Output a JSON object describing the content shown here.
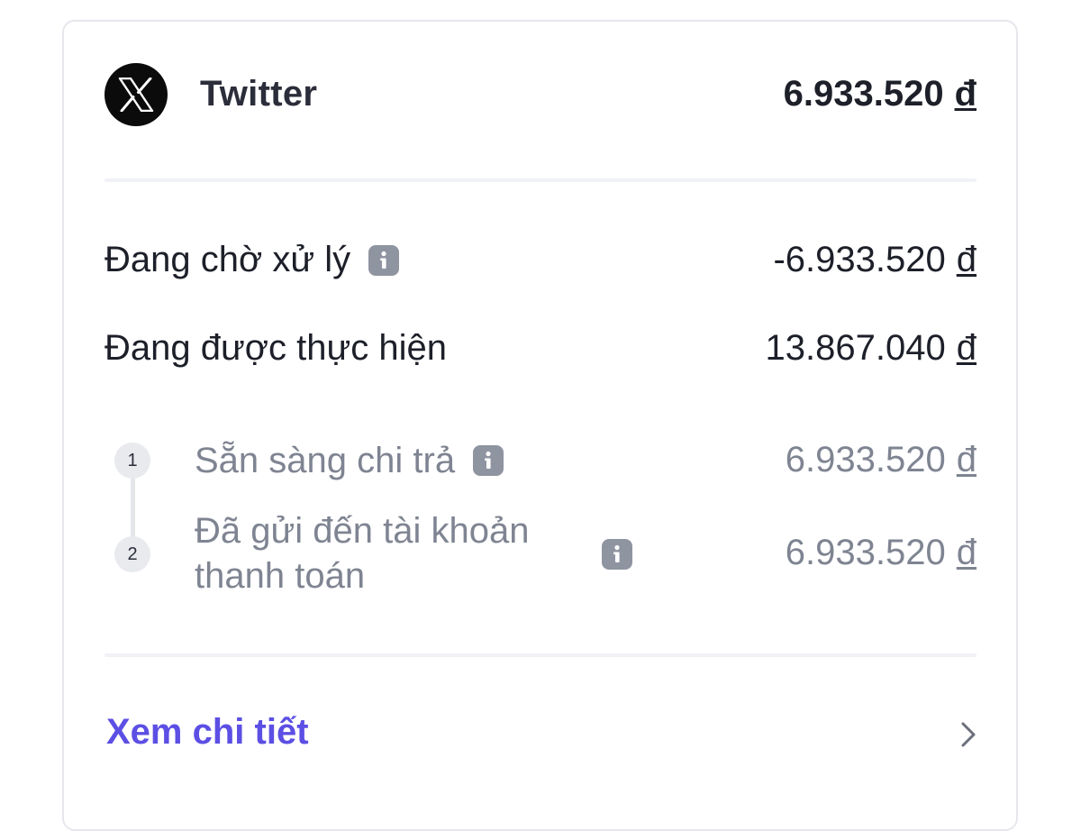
{
  "merchant": {
    "name": "Twitter",
    "logo_icon": "x-logo-icon",
    "amount": "6.933.520",
    "currency": "đ"
  },
  "rows": [
    {
      "label": "Đang chờ xử lý",
      "amount": "-6.933.520",
      "currency": "đ",
      "has_info": true
    },
    {
      "label": "Đang được thực hiện",
      "amount": "13.867.040",
      "currency": "đ",
      "has_info": false
    }
  ],
  "steps": [
    {
      "number": "1",
      "label": "Sẵn sàng chi trả",
      "amount": "6.933.520",
      "currency": "đ"
    },
    {
      "number": "2",
      "label_line1": "Đã gửi đến tài khoản",
      "label_line2": "thanh toán",
      "amount": "6.933.520",
      "currency": "đ"
    }
  ],
  "footer": {
    "link_label": "Xem chi tiết",
    "chevron_icon": "chevron-right-icon"
  },
  "colors": {
    "link": "#5c4fe4",
    "muted_text": "#7f8492",
    "info_icon_bg": "#8f94a1"
  }
}
